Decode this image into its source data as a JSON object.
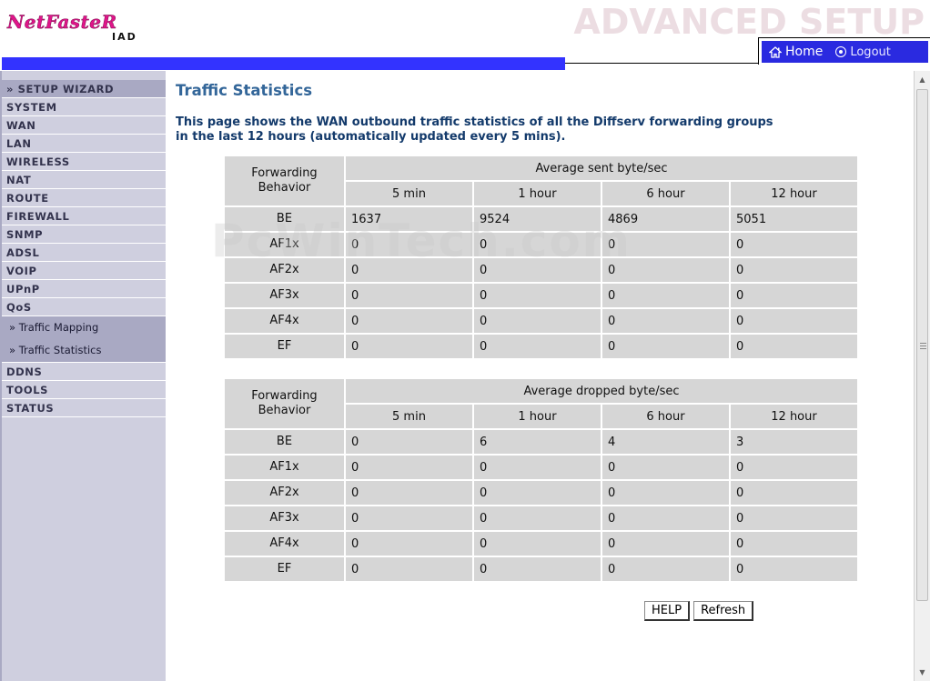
{
  "header": {
    "logo_brand": "NetFasteR",
    "logo_sub": "IAD",
    "title": "ADVANCED SETUP",
    "home_label": "Home",
    "logout_label": "Logout"
  },
  "sidebar": {
    "items": [
      {
        "label": "» SETUP WIZARD"
      },
      {
        "label": "SYSTEM"
      },
      {
        "label": "WAN"
      },
      {
        "label": "LAN"
      },
      {
        "label": "WIRELESS"
      },
      {
        "label": "NAT"
      },
      {
        "label": "ROUTE"
      },
      {
        "label": "FIREWALL"
      },
      {
        "label": "SNMP"
      },
      {
        "label": "ADSL"
      },
      {
        "label": "VOIP"
      },
      {
        "label": "UPnP"
      },
      {
        "label": "QoS"
      }
    ],
    "qos_sub": [
      {
        "label": "» Traffic Mapping"
      },
      {
        "label": "» Traffic Statistics"
      }
    ],
    "items_after": [
      {
        "label": "DDNS"
      },
      {
        "label": "TOOLS"
      },
      {
        "label": "STATUS"
      }
    ]
  },
  "main": {
    "title": "Traffic Statistics",
    "description_line1": "This page shows the WAN outbound traffic statistics of all the Diffserv forwarding groups",
    "description_line2": "in the last 12 hours (automatically updated every 5 mins).",
    "watermark": "PcWinTech.com"
  },
  "sent_table": {
    "fb_header": "Forwarding Behavior",
    "group_header": "Average sent byte/sec",
    "columns": [
      "5 min",
      "1 hour",
      "6 hour",
      "12 hour"
    ],
    "rows": [
      {
        "fb": "BE",
        "values": [
          "1637",
          "9524",
          "4869",
          "5051"
        ]
      },
      {
        "fb": "AF1x",
        "values": [
          "0",
          "0",
          "0",
          "0"
        ]
      },
      {
        "fb": "AF2x",
        "values": [
          "0",
          "0",
          "0",
          "0"
        ]
      },
      {
        "fb": "AF3x",
        "values": [
          "0",
          "0",
          "0",
          "0"
        ]
      },
      {
        "fb": "AF4x",
        "values": [
          "0",
          "0",
          "0",
          "0"
        ]
      },
      {
        "fb": "EF",
        "values": [
          "0",
          "0",
          "0",
          "0"
        ]
      }
    ]
  },
  "dropped_table": {
    "fb_header": "Forwarding Behavior",
    "group_header": "Average dropped byte/sec",
    "columns": [
      "5 min",
      "1 hour",
      "6 hour",
      "12 hour"
    ],
    "rows": [
      {
        "fb": "BE",
        "values": [
          "0",
          "6",
          "4",
          "3"
        ]
      },
      {
        "fb": "AF1x",
        "values": [
          "0",
          "0",
          "0",
          "0"
        ]
      },
      {
        "fb": "AF2x",
        "values": [
          "0",
          "0",
          "0",
          "0"
        ]
      },
      {
        "fb": "AF3x",
        "values": [
          "0",
          "0",
          "0",
          "0"
        ]
      },
      {
        "fb": "AF4x",
        "values": [
          "0",
          "0",
          "0",
          "0"
        ]
      },
      {
        "fb": "EF",
        "values": [
          "0",
          "0",
          "0",
          "0"
        ]
      }
    ]
  },
  "buttons": {
    "help_label": "HELP",
    "refresh_label": "Refresh"
  }
}
